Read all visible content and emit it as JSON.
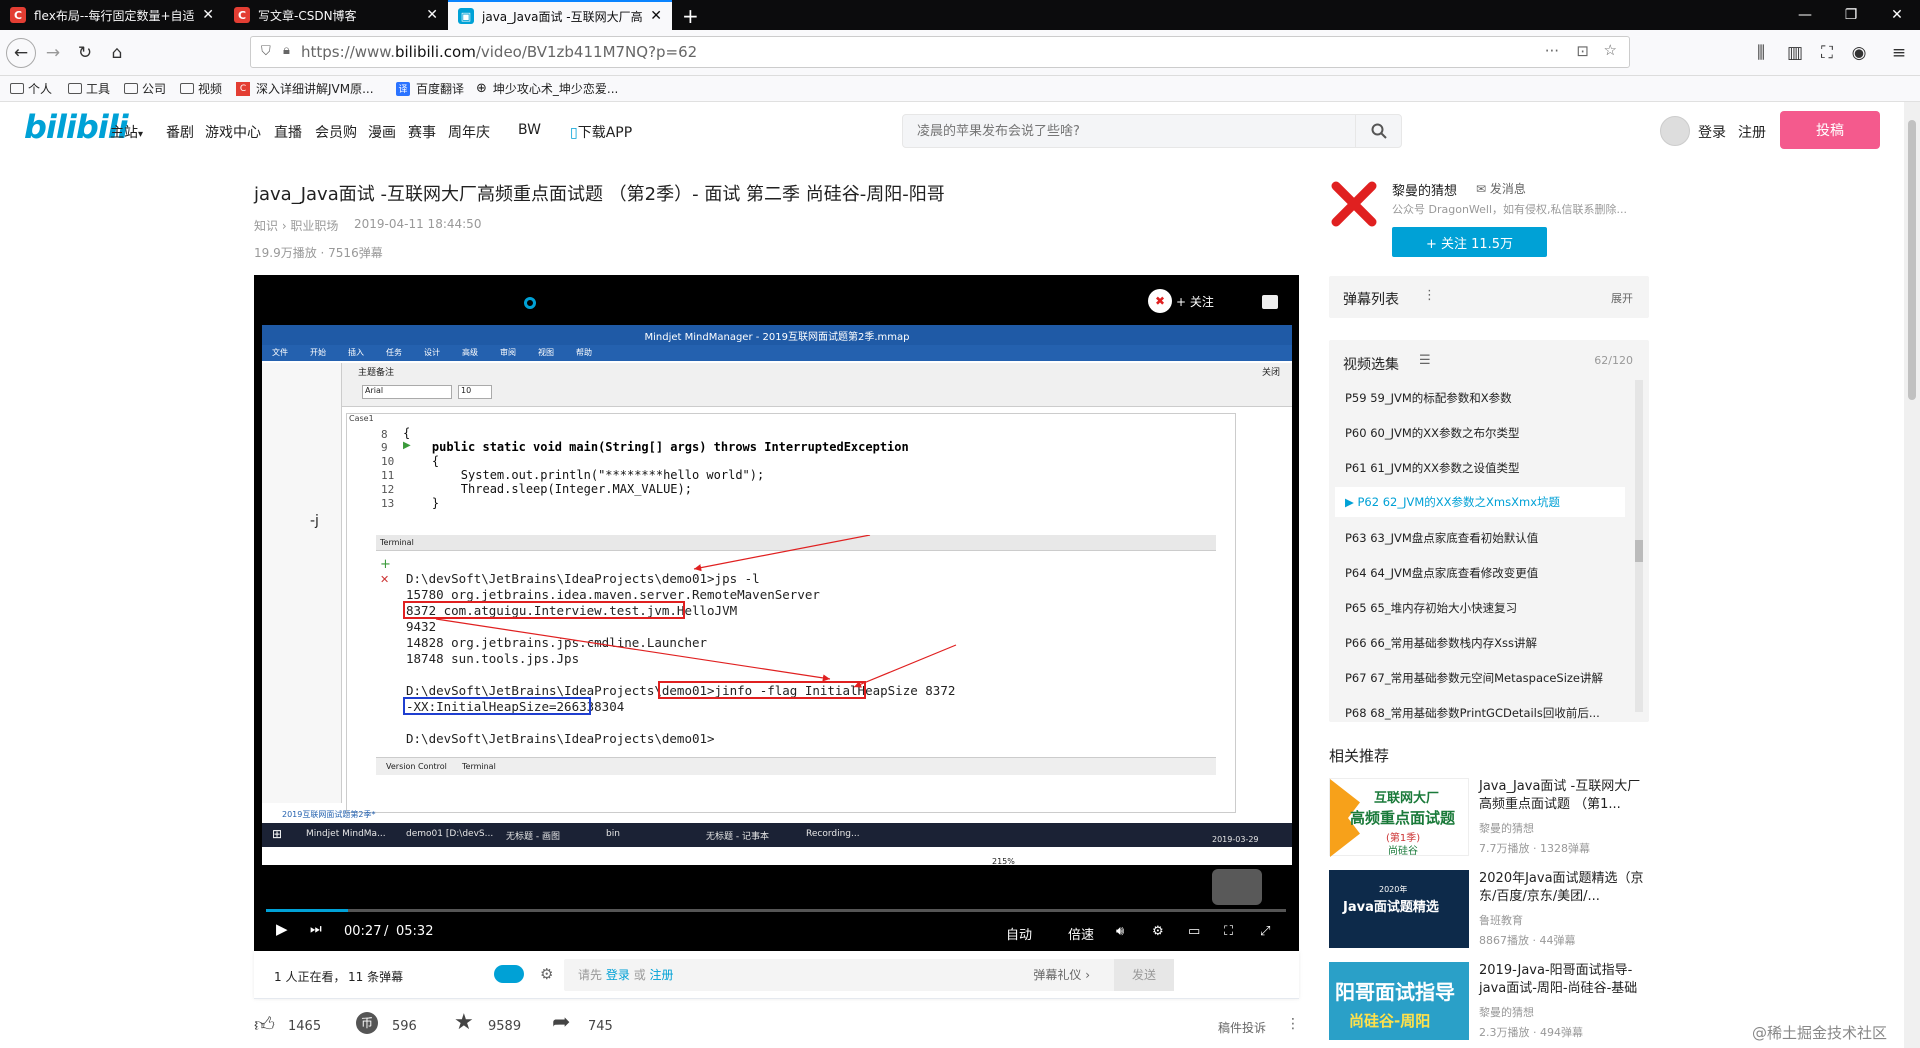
{
  "browser": {
    "tabs": [
      {
        "label": "flex布局--每行固定数量+自适",
        "icon": "C"
      },
      {
        "label": "写文章-CSDN博客",
        "icon": "C"
      },
      {
        "label": "java_Java面试 -互联网大厂高",
        "icon": "bili"
      }
    ],
    "url_prefix": "https://www.",
    "url_domain": "bilibili.com",
    "url_path": "/video/BV1zb411M7NQ?p=62",
    "bookmarks": [
      "个人",
      "工具",
      "公司",
      "视频",
      "深入详细讲解JVM原...",
      "百度翻译",
      "坤少攻心术_坤少恋爱..."
    ]
  },
  "bili": {
    "logo": "bilibili",
    "nav": [
      "主站",
      "番剧",
      "游戏中心",
      "直播",
      "会员购",
      "漫画",
      "赛事",
      "周年庆",
      "BW",
      "下载APP"
    ],
    "search_placeholder": "凌晨的苹果发布会说了些啥?",
    "login": "登录",
    "register": "注册",
    "upload": "投稿"
  },
  "video": {
    "title": "java_Java面试 -互联网大厂高频重点面试题 （第2季）- 面试 第二季 尚硅谷-周阳-阳哥",
    "category": "知识 › 职业职场",
    "date": "2019-04-11 18:44:50",
    "stats": "19.9万播放 · 7516弹幕",
    "time_current": "00:27",
    "time_total": "05:32",
    "progress_fraction": 0.08,
    "player_follow": "+ 关注",
    "ctrl_auto": "自动",
    "ctrl_speed": "倍速",
    "watching": "1 人正在看，",
    "danmaku_count": "11 条弹幕",
    "danmaku_prompt": "请先",
    "danmaku_login": "登录",
    "danmaku_or": "或",
    "danmaku_register": "注册",
    "danmaku_etiquette": "弹幕礼仪 ›",
    "send": "发送",
    "likes": "1465",
    "coins": "596",
    "favorites": "9589",
    "shares": "745",
    "report": "稿件投诉"
  },
  "screen": {
    "mm_title": "Mindjet MindManager - 2019互联网面试题第2季.mmap",
    "mm_menu": [
      "文件",
      "开始",
      "插入",
      "任务",
      "设计",
      "高级",
      "审阅",
      "视图",
      "帮助"
    ],
    "panel_title": "主题备注",
    "font_name": "Arial",
    "font_size": "10",
    "close_label": "关闭",
    "case_label": "Case1",
    "code_lines": [
      {
        "n": "8",
        "text": "{"
      },
      {
        "n": "9",
        "text": "    public static void main(String[] args) throws InterruptedException"
      },
      {
        "n": "10",
        "text": "    {"
      },
      {
        "n": "11",
        "text": "        System.out.println(\"********hello world\");"
      },
      {
        "n": "12",
        "text": "        Thread.sleep(Integer.MAX_VALUE);"
      },
      {
        "n": "13",
        "text": "    }"
      }
    ],
    "terminal_label": "Terminal",
    "terminal_lines": [
      "D:\\devSoft\\JetBrains\\IdeaProjects\\demo01>jps -l",
      "15780 org.jetbrains.idea.maven.server.RemoteMavenServer",
      "8372 com.atguigu.Interview.test.jvm.HelloJVM",
      "9432",
      "14828 org.jetbrains.jps.cmdline.Launcher",
      "18748 sun.tools.jps.Jps",
      "",
      "D:\\devSoft\\JetBrains\\IdeaProjects\\demo01>jinfo -flag InitialHeapSize 8372",
      "-XX:InitialHeapSize=266338304",
      "",
      "D:\\devSoft\\JetBrains\\IdeaProjects\\demo01>"
    ],
    "tabs_bottom": [
      "Version Control",
      "Terminal"
    ],
    "doc_tab": "2019互联网面试题第2季*",
    "zoom": "215%",
    "taskbar": [
      "Mindjet MindMa...",
      "demo01 [D:\\devS...",
      "无标题 - 画图",
      "bin",
      "无标题 - 记事本",
      "Recording..."
    ],
    "taskbar_date": "2019-03-29"
  },
  "uploader": {
    "name": "黎曼的猜想",
    "message": "发消息",
    "desc": "公众号 DragonWell，如有侵权,私信联系删除...",
    "follow": "+ 关注 11.5万"
  },
  "danmaku_list": {
    "title": "弹幕列表",
    "expand": "展开"
  },
  "playlist": {
    "title": "视频选集",
    "count": "62/120",
    "items": [
      "P59  59_JVM的标配参数和X参数",
      "P60  60_JVM的XX参数之布尔类型",
      "P61  61_JVM的XX参数之设值类型",
      "P62  62_JVM的XX参数之XmsXmx坑题",
      "P63  63_JVM盘点家底查看初始默认值",
      "P64  64_JVM盘点家底查看修改变更值",
      "P65  65_堆内存初始大小快速复习",
      "P66  66_常用基础参数栈内存Xss讲解",
      "P67  67_常用基础参数元空间MetaspaceSize讲解",
      "P68  68_常用基础参数PrintGCDetails回收前后..."
    ],
    "active_index": 3
  },
  "related": {
    "title": "相关推荐",
    "items": [
      {
        "thumb_title": "互联网大厂",
        "thumb_sub": "高频重点面试题",
        "thumb_tag": "(第1季)",
        "thumb_brand": "尚硅谷",
        "title": "Java_Java面试 -互联网大厂高频重点面试题 （第1...",
        "author": "黎曼的猜想",
        "stats": "7.7万播放 · 1328弹幕"
      },
      {
        "thumb_title": "2020年",
        "thumb_sub": "Java面试题精选",
        "thumb_tag": "",
        "thumb_brand": "",
        "title": "2020年Java面试题精选（京东/百度/京东/美团/...",
        "author": "鲁班教育",
        "stats": "8867播放 · 44弹幕"
      },
      {
        "thumb_title": "阳哥面试指导",
        "thumb_sub": "尚硅谷-周阳",
        "thumb_tag": "",
        "thumb_brand": "",
        "title": "2019-Java-阳哥面试指导-java面试-周阳-尚硅谷-基础",
        "author": "黎曼的猜想",
        "stats": "2.3万播放 · 494弹幕"
      }
    ]
  },
  "watermark": "@稀土掘金技术社区",
  "colors": {
    "bili_blue": "#00a1d6",
    "upload_pink": "#f45a8d",
    "red_box": "#e02020",
    "blue_box": "#1f3fd0"
  }
}
